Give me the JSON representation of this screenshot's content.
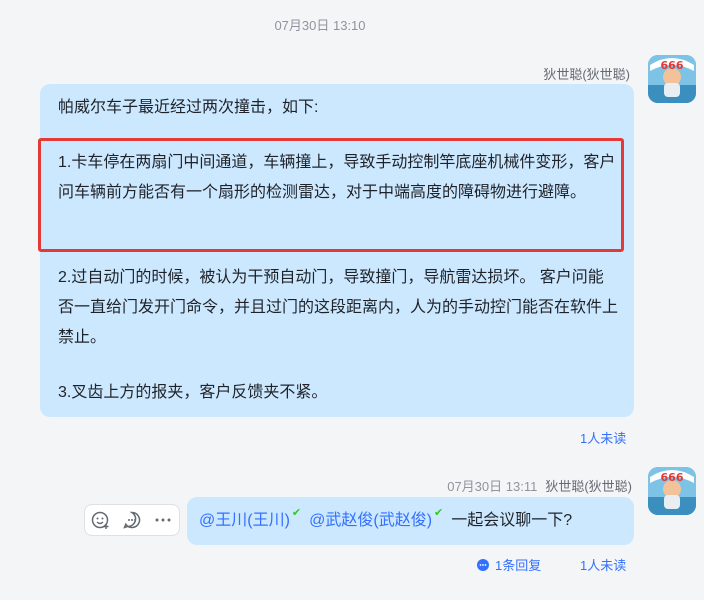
{
  "top_timestamp": "07月30日 13:10",
  "message1": {
    "sender": "狄世聪(狄世聪)",
    "intro": "帕威尔车子最近经过两次撞击，如下:",
    "paragraph1": "1.卡车停在两扇门中间通道，车辆撞上，导致手动控制竿底座机械件变形，客户问车辆前方能否有一个扇形的检测雷达，对于中端高度的障碍物进行避障。",
    "paragraph2": "2.过自动门的时候，被认为干预自动门，导致撞门，导航雷达损坏。 客户问能否一直给门发开门命令，并且过门的这段距离内，人为的手动控门能否在软件上禁止。",
    "paragraph3": "3.叉齿上方的报夹，客户反馈夹不紧。",
    "unread": "1人未读"
  },
  "message2": {
    "time": "07月30日 13:11",
    "sender": "狄世聪(狄世聪)",
    "mention1": "@王川(王川)",
    "mention2": "@武赵俊(武赵俊)",
    "text": "一起会议聊一下?",
    "reply": "1条回复",
    "unread": "1人未读"
  },
  "avatar_badge": "666",
  "colors": {
    "bubble": "#cce8ff",
    "accent": "#3370ff",
    "highlight": "#e53935"
  }
}
